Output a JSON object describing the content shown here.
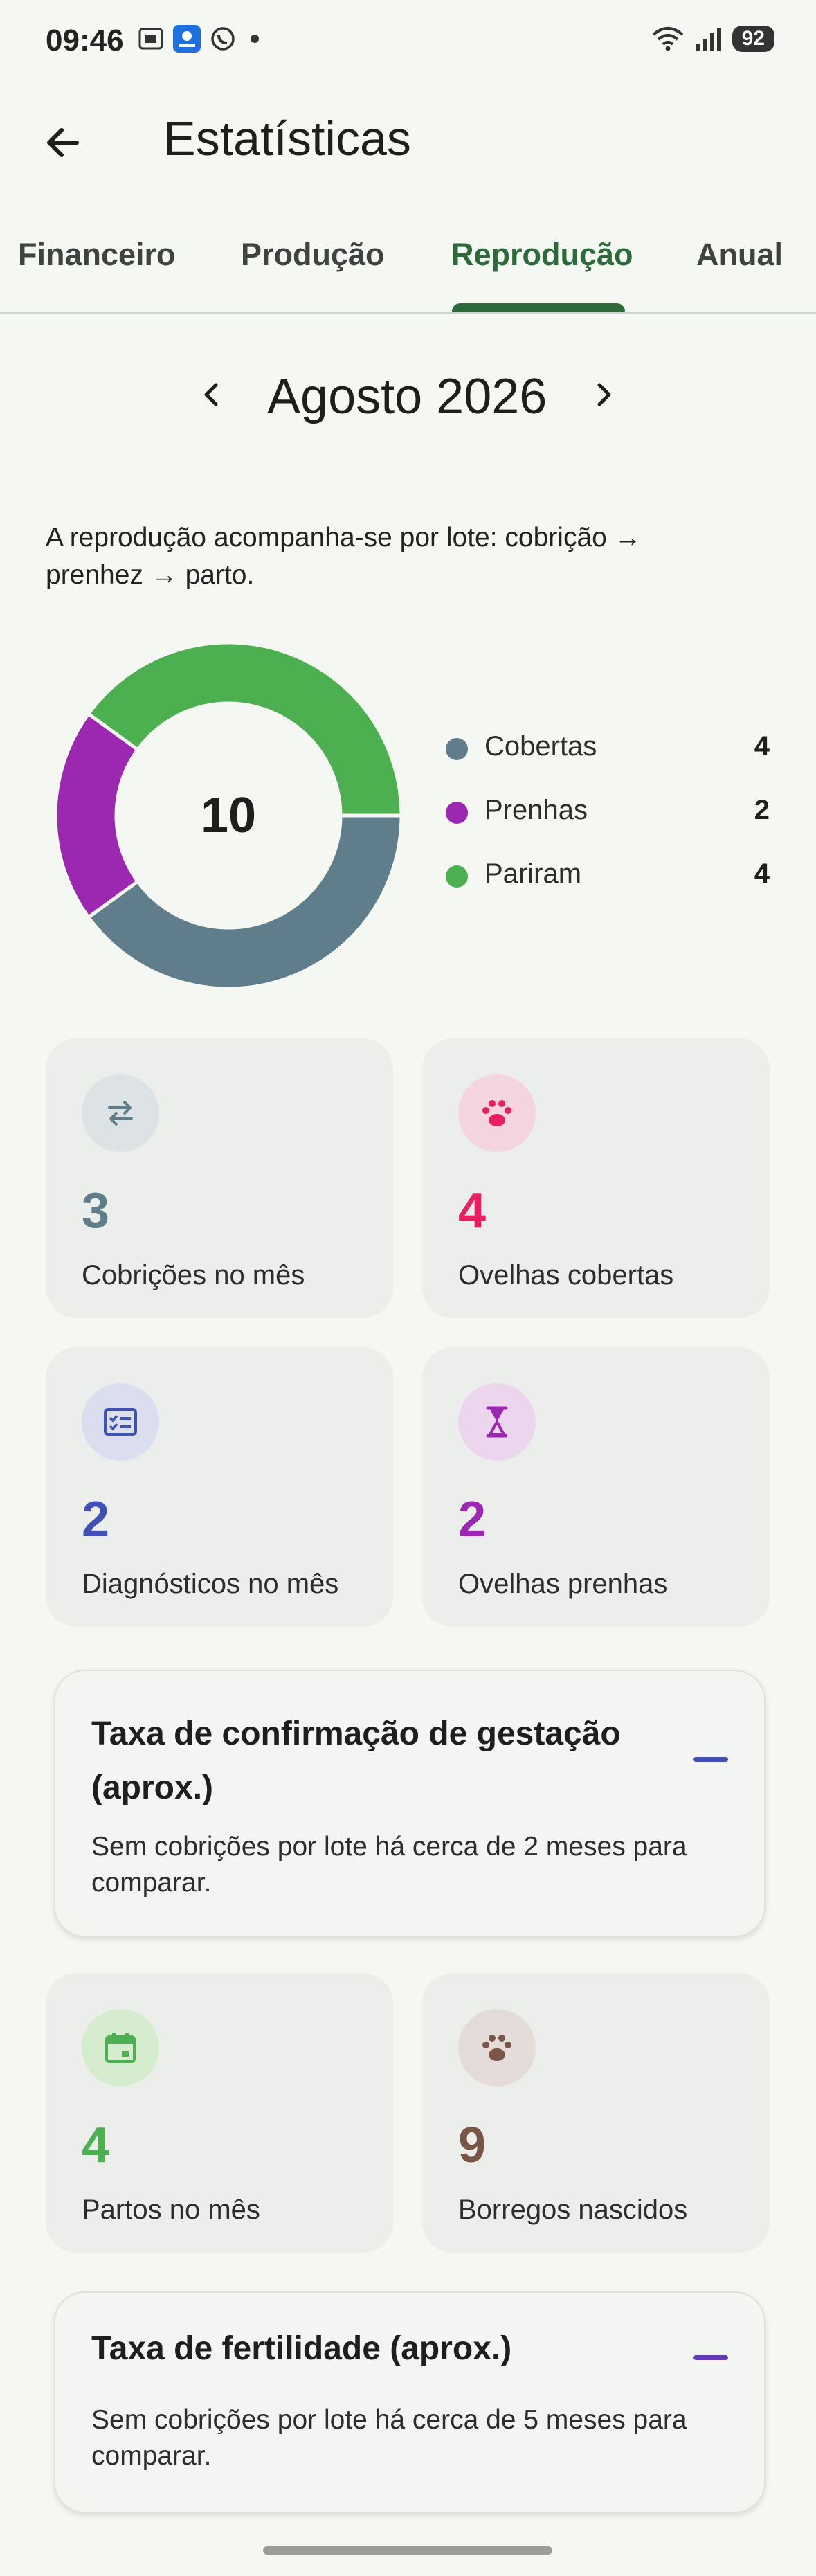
{
  "status_bar": {
    "time": "09:46",
    "battery": "92",
    "icons": [
      "screenshot-icon",
      "app-icon",
      "whatsapp-icon",
      "notification-dot",
      "wifi-icon",
      "signal-icon",
      "battery-icon"
    ]
  },
  "app_bar": {
    "title": "Estatísticas"
  },
  "tabs": [
    {
      "label": "Financeiro",
      "active": false
    },
    {
      "label": "Produção",
      "active": false
    },
    {
      "label": "Reprodução",
      "active": true
    },
    {
      "label": "Anual",
      "active": false
    }
  ],
  "month_selector": {
    "label": "Agosto 2026"
  },
  "intro": "A reprodução acompanha-se por lote: cobrição → prenhez → parto.",
  "chart_data": {
    "type": "pie",
    "donut": true,
    "center_label": "10",
    "categories": [
      "Cobertas",
      "Prenhas",
      "Pariram"
    ],
    "values": [
      4,
      2,
      4
    ],
    "colors": [
      "#607d8b",
      "#9c27b0",
      "#4caf50"
    ],
    "legend_position": "right"
  },
  "legend": [
    {
      "label": "Cobertas",
      "value": "4",
      "color": "#607d8b"
    },
    {
      "label": "Prenhas",
      "value": "2",
      "color": "#9c27b0"
    },
    {
      "label": "Pariram",
      "value": "4",
      "color": "#4caf50"
    }
  ],
  "cards": {
    "cobricoes": {
      "value": "3",
      "label": "Cobrições no mês",
      "color": "#607d8b",
      "icon": "swap-icon"
    },
    "ovelhas_cobertas": {
      "value": "4",
      "label": "Ovelhas cobertas",
      "color": "#e91e63",
      "icon": "paw-icon"
    },
    "diagnosticos": {
      "value": "2",
      "label": "Diagnósticos no mês",
      "color": "#3f51b5",
      "icon": "checklist-icon"
    },
    "ovelhas_prenhas": {
      "value": "2",
      "label": "Ovelhas prenhas",
      "color": "#9c27b0",
      "icon": "hourglass-icon"
    },
    "partos": {
      "value": "4",
      "label": "Partos no mês",
      "color": "#4caf50",
      "icon": "calendar-icon"
    },
    "borregos": {
      "value": "9",
      "label": "Borregos nascidos",
      "color": "#795548",
      "icon": "paw-icon"
    }
  },
  "rate_gestacao": {
    "title": "Taxa de confirmação de gestação (aprox.)",
    "subtitle": "Sem cobrições por lote há cerca de 2 meses para comparar.",
    "indicator": "—",
    "color": "#3f51b5"
  },
  "rate_fertilidade": {
    "title": "Taxa de fertilidade (aprox.)",
    "subtitle": "Sem cobrições por lote há cerca de 5 meses para comparar.",
    "indicator": "—",
    "color": "#673ab7"
  }
}
